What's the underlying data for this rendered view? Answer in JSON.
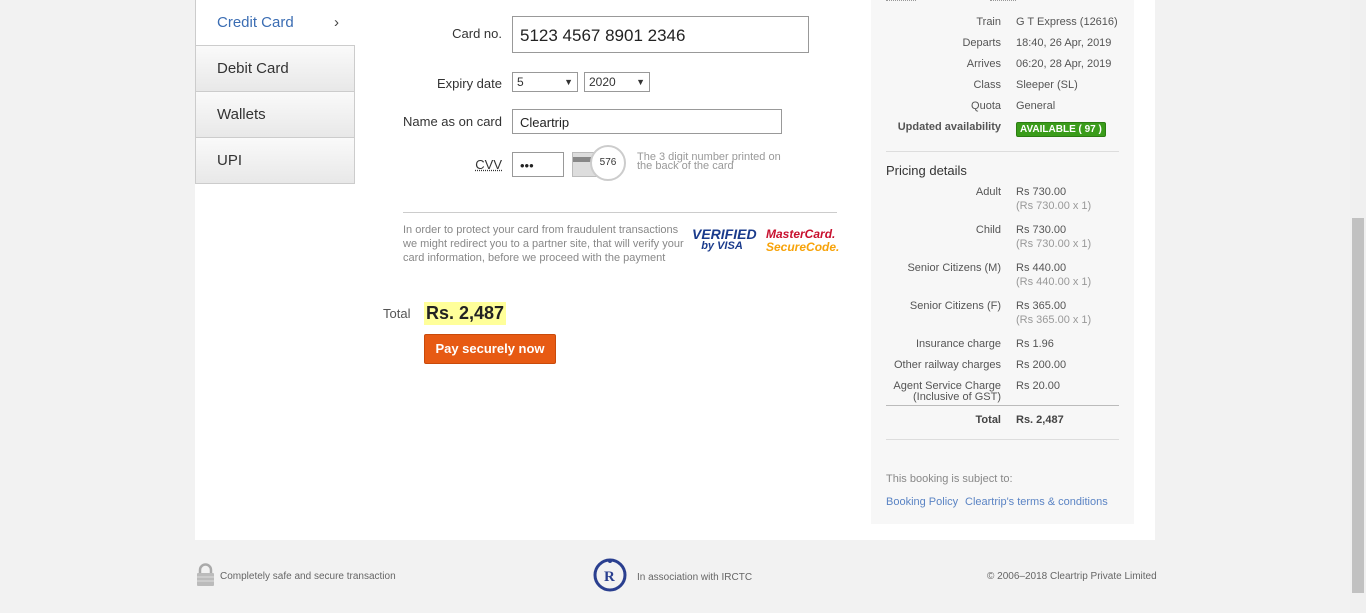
{
  "tabs": [
    {
      "label": "Credit Card",
      "chevron": "›"
    },
    {
      "label": "Debit Card"
    },
    {
      "label": "Wallets"
    },
    {
      "label": "UPI"
    }
  ],
  "form": {
    "card_no_label": "Card no.",
    "card_no_value": "5123 4567 8901 2346",
    "expiry_label": "Expiry date",
    "expiry_month": "5",
    "expiry_year": "2020",
    "name_label": "Name as on card",
    "name_value": "Cleartrip",
    "cvv_label": "CVV",
    "cvv_value": "•••",
    "cvv_card_number": "576",
    "cvv_hint_1": "The 3 digit number printed on",
    "cvv_hint_2": "the back of the card",
    "secure_text": "In order to protect your card from fraudulent transactions we might redirect you to a partner site, that will verify your card information, before we proceed with the payment",
    "visa_logo_1": "VERIFIED",
    "visa_logo_2": "by VISA",
    "mc_logo_1": "MasterCard.",
    "mc_logo_2": "SecureCode.",
    "total_label": "Total",
    "total_amount": "Rs. 2,487",
    "pay_button": "Pay securely now"
  },
  "trip": {
    "train_k": "Train",
    "train_v": "G T Express (12616)",
    "departs_k": "Departs",
    "departs_v": "18:40, 26 Apr, 2019",
    "arrives_k": "Arrives",
    "arrives_v": "06:20, 28 Apr, 2019",
    "class_k": "Class",
    "class_v": "Sleeper (SL)",
    "quota_k": "Quota",
    "quota_v": "General",
    "avail_k": "Updated availability",
    "avail_v": "AVAILABLE ( 97 )"
  },
  "pricing": {
    "title": "Pricing details",
    "adult_k": "Adult",
    "adult_v": "Rs 730.00",
    "adult_sub": "(Rs 730.00 x 1)",
    "child_k": "Child",
    "child_v": "Rs 730.00",
    "child_sub": "(Rs 730.00 x 1)",
    "scm_k": "Senior Citizens (M)",
    "scm_v": "Rs 440.00",
    "scm_sub": "(Rs 440.00 x 1)",
    "scf_k": "Senior Citizens (F)",
    "scf_v": "Rs 365.00",
    "scf_sub": "(Rs 365.00 x 1)",
    "ins_k": "Insurance charge",
    "ins_v": "Rs 1.96",
    "other_k": "Other railway charges",
    "other_v": "Rs 200.00",
    "agent_k1": "Agent Service Charge",
    "agent_k2": "(Inclusive of GST)",
    "agent_v": "Rs 20.00",
    "total_k": "Total",
    "total_v": "Rs. 2,487",
    "subject_text": "This booking is subject to:",
    "booking_policy": "Booking Policy",
    "terms": "Cleartrip's terms & conditions"
  },
  "footer": {
    "secure": "Completely safe and secure transaction",
    "irctc": "In association with IRCTC",
    "copyright": "© 2006–2018 Cleartrip Private Limited"
  },
  "colors": {
    "accent": "#3b6db3",
    "pay": "#e75a13",
    "available": "#3a9c1a",
    "highlight": "#ffff9a"
  }
}
